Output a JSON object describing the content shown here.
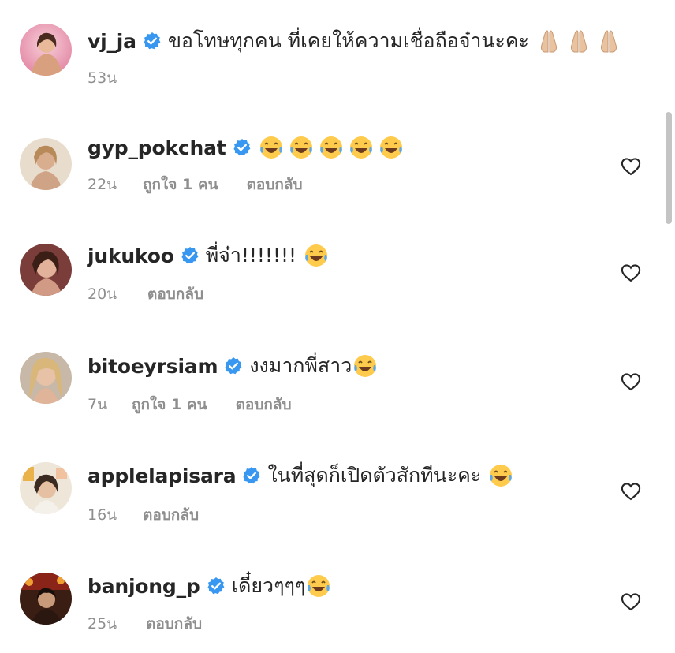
{
  "caption": {
    "username": "vj_ja",
    "text": "ขอโทษทุกคน ที่เคยให้ความเชื่อถือจ๋านะคะ",
    "emoji": [
      "folded-hands",
      "folded-hands",
      "folded-hands"
    ],
    "time": "53น"
  },
  "comments": [
    {
      "username": "gyp_pokchat",
      "text": "",
      "emoji": [
        "tears-of-joy",
        "tears-of-joy",
        "tears-of-joy",
        "tears-of-joy",
        "tears-of-joy"
      ],
      "time": "22น",
      "likes": "ถูกใจ 1 คน",
      "reply": "ตอบกลับ"
    },
    {
      "username": "jukukoo",
      "text": "พี่จ๋า!!!!!!!",
      "emoji": [
        "tears-of-joy"
      ],
      "time": "20น",
      "likes": "",
      "reply": "ตอบกลับ"
    },
    {
      "username": "bitoeyrsiam",
      "text": "งงมากพี่สาว",
      "emoji": [
        "tears-of-joy"
      ],
      "time": "7น",
      "likes": "ถูกใจ 1 คน",
      "reply": "ตอบกลับ"
    },
    {
      "username": "applelapisara",
      "text": "ในที่สุดก็เปิดตัวสักทีนะคะ",
      "emoji": [
        "tears-of-joy"
      ],
      "time": "16น",
      "likes": "",
      "reply": "ตอบกลับ"
    },
    {
      "username": "banjong_p",
      "text": "เดี๋ยวๆๆๆ",
      "emoji": [
        "tears-of-joy"
      ],
      "time": "25น",
      "likes": "",
      "reply": "ตอบกลับ"
    }
  ],
  "colors": {
    "verified": "#3897f0",
    "muted": "#8e8e8e",
    "divider": "#dbdbdb"
  }
}
